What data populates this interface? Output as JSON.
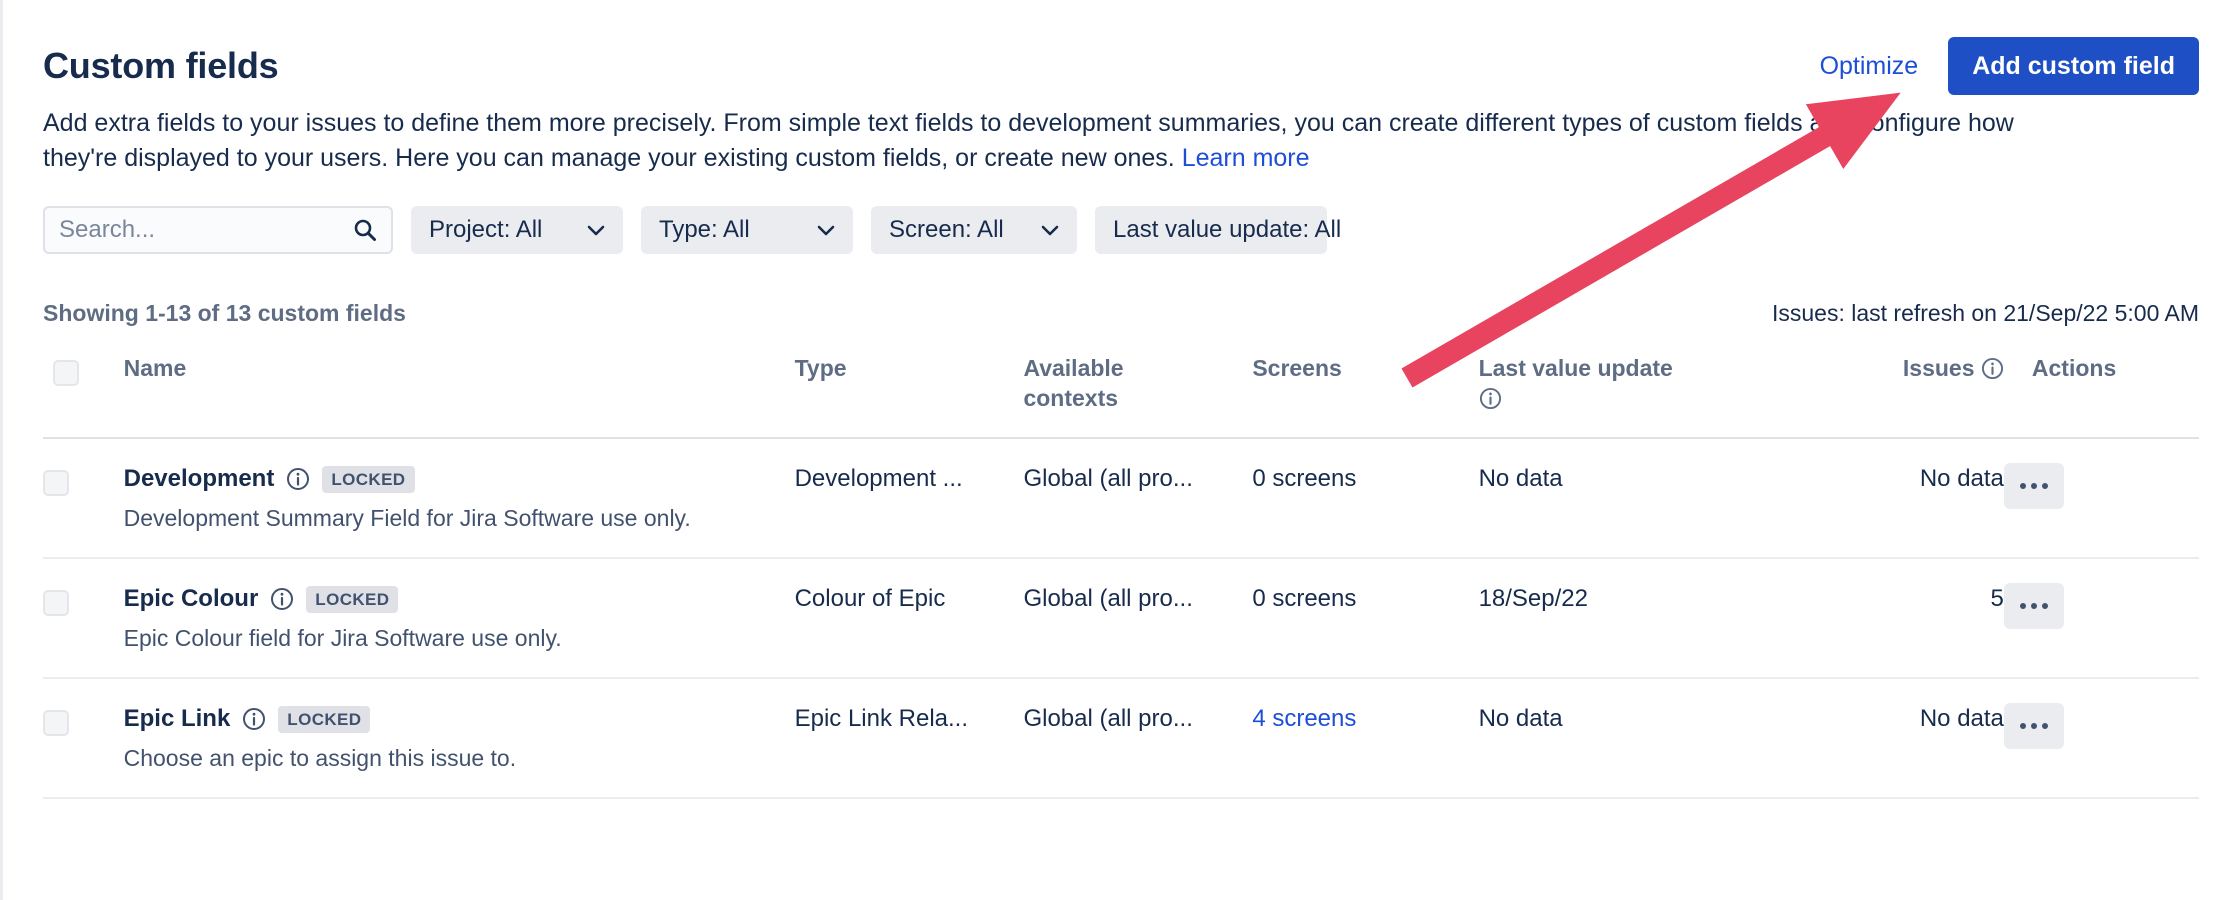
{
  "header": {
    "title": "Custom fields",
    "optimize_label": "Optimize",
    "add_custom_field_label": "Add custom field"
  },
  "description": {
    "text": "Add extra fields to your issues to define them more precisely. From simple text fields to development summaries, you can create different types of custom fields and configure how they're displayed to your users. Here you can manage your existing custom fields, or create new ones. ",
    "learn_more_label": "Learn more"
  },
  "filters": {
    "search_placeholder": "Search...",
    "search_value": "",
    "search_icon": "search-icon",
    "chips": [
      {
        "label": "Project: All",
        "icon": "chevron-down-icon"
      },
      {
        "label": "Type: All",
        "icon": "chevron-down-icon"
      },
      {
        "label": "Screen: All",
        "icon": "chevron-down-icon"
      },
      {
        "label": "Last value update: All",
        "icon": "chevron-down-icon"
      }
    ]
  },
  "meta": {
    "showing": "Showing 1-13 of 13 custom fields",
    "refresh": "Issues: last refresh on 21/Sep/22 5:00 AM"
  },
  "table": {
    "columns": {
      "name": "Name",
      "type": "Type",
      "available_contexts_line1": "Available",
      "available_contexts_line2": "contexts",
      "screens": "Screens",
      "last_value_update": "Last value update",
      "issues": "Issues",
      "actions": "Actions"
    },
    "rows": [
      {
        "name": "Development",
        "badge": "LOCKED",
        "description": "Development Summary Field for Jira Software use only.",
        "type": "Development ...",
        "contexts": "Global (all pro...",
        "screens": "0 screens",
        "screens_is_link": false,
        "last_value_update": "No data",
        "issues": "No data",
        "actions": "..."
      },
      {
        "name": "Epic Colour",
        "badge": "LOCKED",
        "description": "Epic Colour field for Jira Software use only.",
        "type": "Colour of Epic",
        "contexts": "Global (all pro...",
        "screens": "0 screens",
        "screens_is_link": false,
        "last_value_update": "18/Sep/22",
        "issues": "5",
        "actions": "..."
      },
      {
        "name": "Epic Link",
        "badge": "LOCKED",
        "description": "Choose an epic to assign this issue to.",
        "type": "Epic Link Rela...",
        "contexts": "Global (all pro...",
        "screens": "4 screens",
        "screens_is_link": true,
        "last_value_update": "No data",
        "issues": "No data",
        "actions": "..."
      }
    ]
  },
  "annotation": {
    "arrow_color": "#E8445F",
    "points_to": "add-custom-field-button"
  },
  "colors": {
    "primary": "#1e4fc4",
    "link": "#1d4ed8",
    "text": "#172b4d",
    "subtle_text": "#5e6c84",
    "chip_bg": "#ebecf0",
    "annotation_red": "#E8445F"
  }
}
